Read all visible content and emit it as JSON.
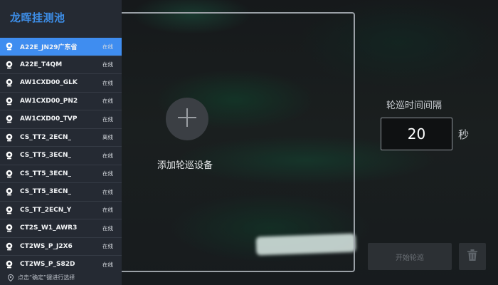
{
  "app": {
    "title": "龙晖挂测池"
  },
  "devices": [
    {
      "name": "A22E_JN29广东省",
      "status": "在线",
      "active": true
    },
    {
      "name": "A22E_T4QM",
      "status": "在线"
    },
    {
      "name": "AW1CXD00_GLK",
      "status": "在线"
    },
    {
      "name": "AW1CXD00_PN2",
      "status": "在线"
    },
    {
      "name": "AW1CXD00_TVP",
      "status": "在线"
    },
    {
      "name": "CS_TT2_2ECN_",
      "status": "离线"
    },
    {
      "name": "CS_TT5_3ECN_",
      "status": "在线"
    },
    {
      "name": "CS_TT5_3ECN_",
      "status": "在线"
    },
    {
      "name": "CS_TT5_3ECN_",
      "status": "在线"
    },
    {
      "name": "CS_TT_2ECN_Y",
      "status": "在线"
    },
    {
      "name": "CT2S_W1_AWR3",
      "status": "在线"
    },
    {
      "name": "CT2WS_P_J2X6",
      "status": "在线"
    },
    {
      "name": "CT2WS_P_S82D",
      "status": "在线"
    }
  ],
  "hint": {
    "text": "点击“确定”键进行选择",
    "icon": "location-pin-icon"
  },
  "add_device": {
    "label": "添加轮巡设备",
    "icon": "plus-icon"
  },
  "interval": {
    "title": "轮巡时间间隔",
    "value": "20",
    "unit": "秒"
  },
  "actions": {
    "start_label": "开始轮巡",
    "delete_icon": "trash-icon"
  },
  "colors": {
    "accent": "#3f8df0",
    "title": "#3d8ee8",
    "sidebar": "#252a33"
  }
}
